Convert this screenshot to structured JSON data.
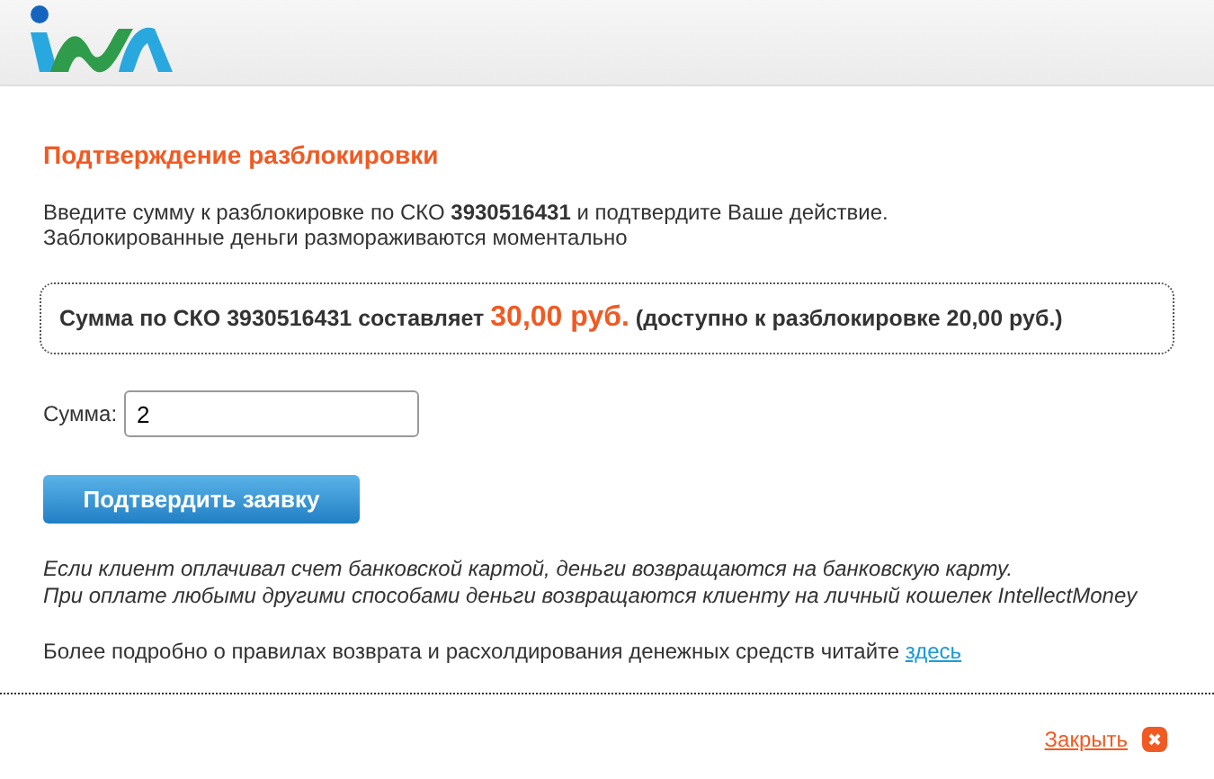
{
  "title": "Подтверждение разблокировки",
  "intro": [
    "Введите сумму к разблокировке по СКО **3930516431** и подтвердите Ваше действие.",
    "Заблокированные деньги размораживаются моментально"
  ],
  "summary": {
    "before": "Сумма по СКО 3930516431 составляет",
    "amount": "30,00 руб.",
    "after": "(доступно к разблокировке 20,00 руб.)"
  },
  "amount_field": {
    "label": "Сумма:",
    "value": "2"
  },
  "submit_button": "Подтвердить заявку",
  "notes": [
    "Если клиент оплачивал счет банковской картой, деньги возвращаются на банковскую карту.",
    "При оплате любыми другими способами деньги возвращаются клиенту на личный кошелек IntellectMoney"
  ],
  "more_info": {
    "text": "Более подробно о правилах возврата и расхолдирования денежных средств читайте",
    "link": "здесь"
  },
  "close_link": "Закрыть"
}
